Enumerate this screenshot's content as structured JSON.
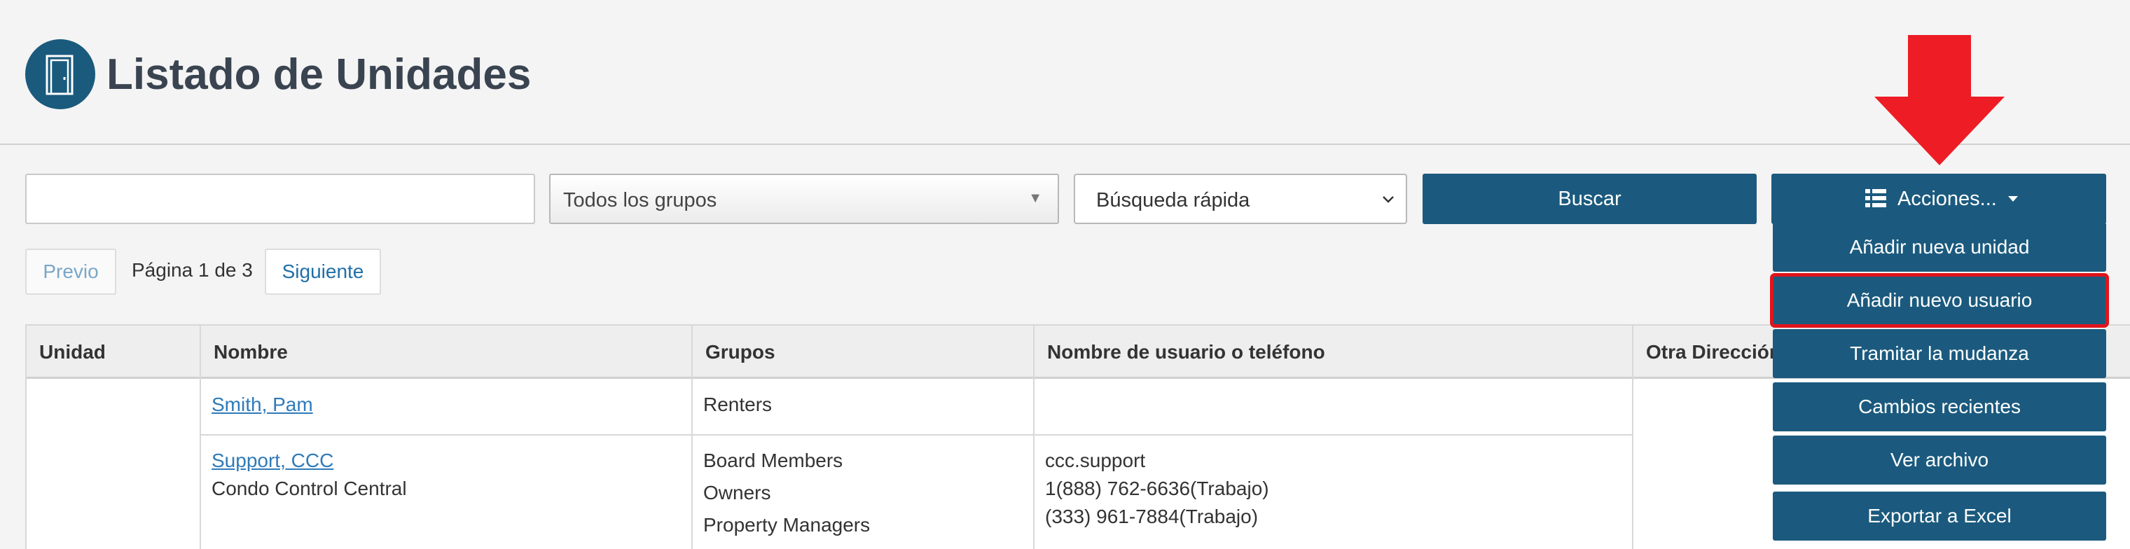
{
  "header": {
    "title": "Listado de Unidades",
    "icon": "door-icon",
    "icon_bg": "#1a5a7d"
  },
  "toolbar": {
    "search_value": "",
    "group_select": "Todos los grupos",
    "quick_search": "Búsqueda rápida",
    "search_button": "Buscar",
    "actions_button": "Acciones...",
    "accent": "#1b5a7e"
  },
  "pagination": {
    "prev": "Previo",
    "info": "Página 1 de 3",
    "next": "Siguiente"
  },
  "table": {
    "columns": [
      "Unidad",
      "Nombre",
      "Grupos",
      "Nombre de usuario o teléfono",
      "Otra Dirección"
    ],
    "rows": [
      {
        "unidad": "",
        "nombre": "Smith, Pam",
        "nombre_sub": "",
        "grupos": [
          "Renters"
        ],
        "contacto": []
      },
      {
        "unidad": "",
        "nombre": "Support, CCC",
        "nombre_sub": "Condo Control Central",
        "grupos": [
          "Board Members",
          "Owners",
          "Property Managers"
        ],
        "contacto": [
          "ccc.support",
          "1(888) 762-6636(Trabajo)",
          "(333) 961-7884(Trabajo)"
        ]
      }
    ]
  },
  "actions_menu": {
    "items": [
      "Añadir nueva unidad",
      "Añadir nuevo usuario",
      "Tramitar la mudanza",
      "Cambios recientes",
      "Ver archivo",
      "Exportar a Excel"
    ],
    "highlighted_index": 1,
    "highlight_color": "#e0141c"
  },
  "annotation": {
    "arrow_color": "#ee1c25"
  }
}
